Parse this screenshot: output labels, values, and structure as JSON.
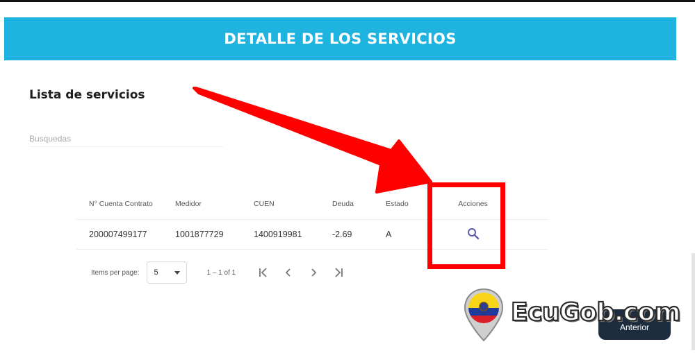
{
  "banner": {
    "title": "DETALLE DE LOS SERVICIOS"
  },
  "section": {
    "title": "Lista de servicios"
  },
  "search": {
    "placeholder": "Busquedas",
    "value": ""
  },
  "table": {
    "headers": [
      "N° Cuenta Contrato",
      "Medidor",
      "CUEN",
      "Deuda",
      "Estado",
      "Acciones"
    ],
    "rows": [
      {
        "cuenta_contrato": "200007499177",
        "medidor": "1001877729",
        "cuen": "1400919981",
        "deuda": "-2.69",
        "estado": "A",
        "accion_icon": "search-icon"
      }
    ]
  },
  "paginator": {
    "items_per_page_label": "Items per page:",
    "items_per_page_value": "5",
    "range_label": "1 – 1 of 1",
    "buttons": [
      "first-page-icon",
      "previous-page-icon",
      "next-page-icon",
      "last-page-icon"
    ]
  },
  "footer": {
    "anterior_label": "Anterior"
  },
  "watermark": {
    "text": "EcuGob.com"
  },
  "colors": {
    "banner": "#1fb3e0",
    "annotation": "#ff0000",
    "icon": "#5a5aa8",
    "button": "#1d2d3f"
  }
}
